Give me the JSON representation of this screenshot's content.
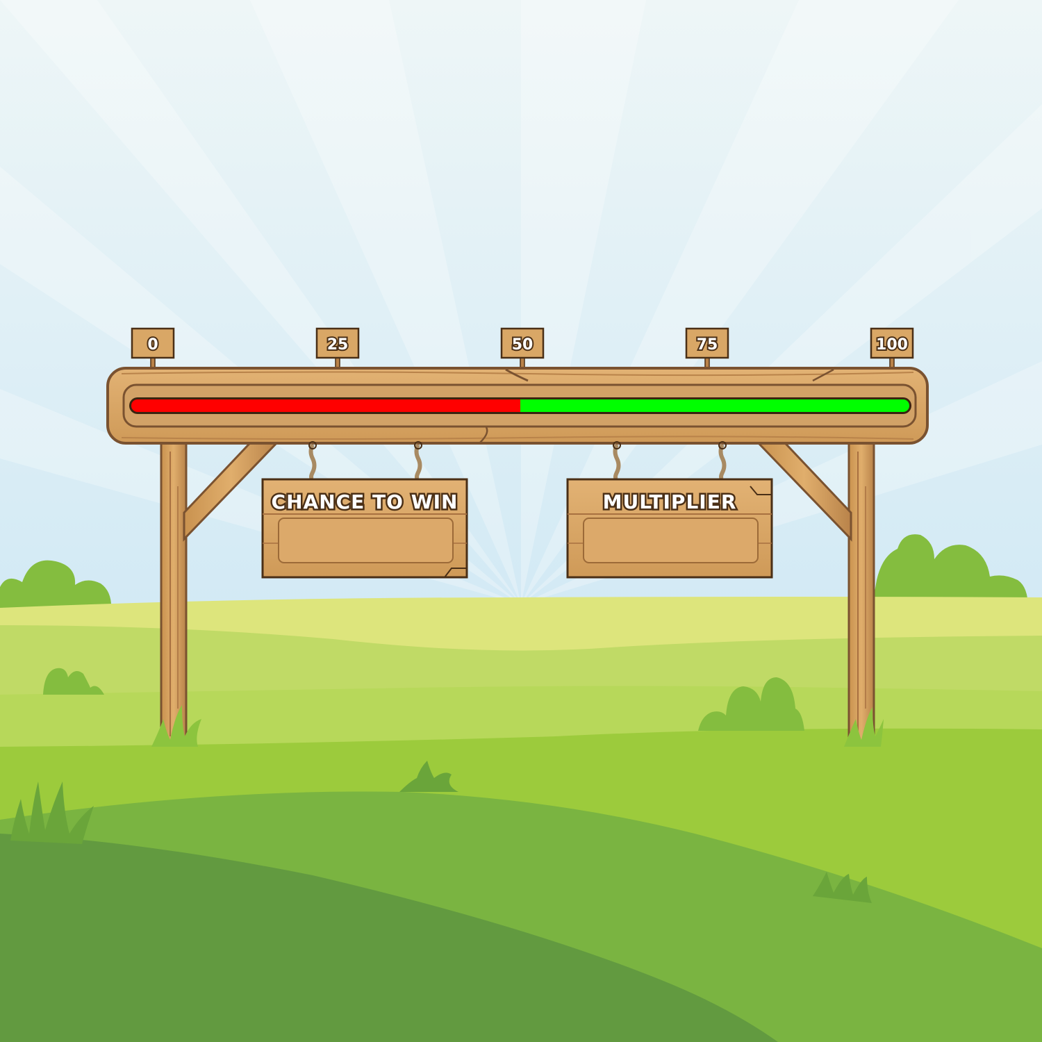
{
  "scale": {
    "ticks": [
      "0",
      "25",
      "50",
      "75",
      "100"
    ],
    "min": 0,
    "max": 100
  },
  "bar": {
    "split_value": 50,
    "left_color": "#ff0000",
    "right_color": "#00ff00"
  },
  "signs": {
    "chance_to_win": {
      "title": "CHANCE TO WIN",
      "value": ""
    },
    "multiplier": {
      "title": "MULTIPLIER",
      "value": ""
    }
  },
  "colors": {
    "sky_top": "#eef6f7",
    "sky_bottom": "#bfe1f3",
    "wood": "#d9a766",
    "wood_dark": "#7a5230",
    "grass_light": "#dde57c",
    "grass_mid": "#9ccb3c",
    "grass_dark": "#5f9642"
  }
}
